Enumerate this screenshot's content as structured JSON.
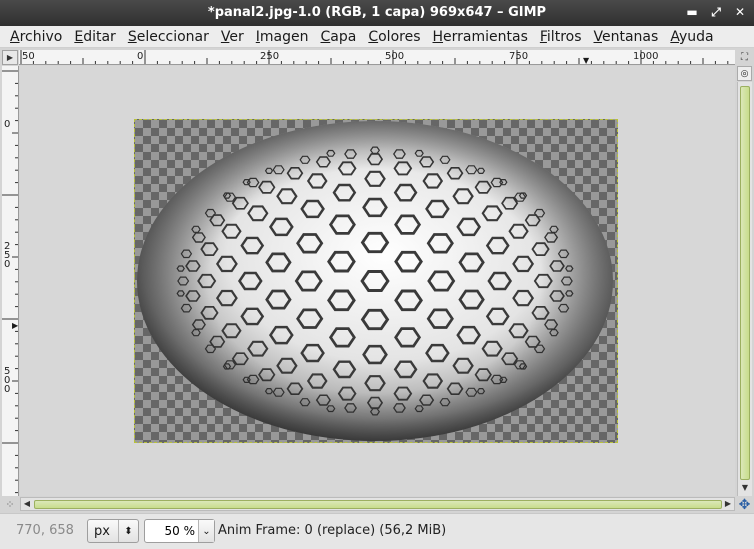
{
  "window": {
    "title": "*panal2.jpg-1.0 (RGB, 1 capa) 969x647 – GIMP",
    "buttons": {
      "minimize": "▬",
      "maximize": "⤢",
      "close": "✕"
    }
  },
  "menu": {
    "items": [
      {
        "first": "A",
        "rest": "rchivo"
      },
      {
        "first": "E",
        "rest": "ditar"
      },
      {
        "first": "S",
        "rest": "eleccionar"
      },
      {
        "first": "V",
        "rest": "er"
      },
      {
        "first": "I",
        "rest": "magen"
      },
      {
        "first": "C",
        "rest": "apa"
      },
      {
        "first": "C",
        "rest": "olores"
      },
      {
        "first": "H",
        "rest": "erramientas"
      },
      {
        "first": "F",
        "rest": "iltros"
      },
      {
        "first": "V",
        "rest": "entanas"
      },
      {
        "first": "A",
        "rest": "yuda"
      }
    ]
  },
  "hruler": {
    "labels": [
      "50",
      "0",
      "250",
      "500",
      "750",
      "1000"
    ]
  },
  "vruler": {
    "labels": [
      "0",
      "250",
      "500"
    ]
  },
  "status": {
    "coords": "770, 658",
    "unit": "px",
    "zoom": "50 %",
    "message": "Anim Frame: 0 (replace) (56,2 MiB)"
  },
  "icons": {
    "corner": "menu-arrow-icon",
    "navigate": "zoom-navigate-icon",
    "quickmask": "quick-mask-icon",
    "nav_cross": "navigation-cross-icon"
  }
}
